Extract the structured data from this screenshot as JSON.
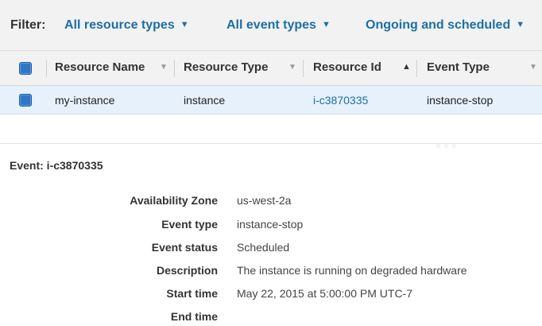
{
  "filter": {
    "label": "Filter:",
    "resource_types": "All resource types",
    "event_types": "All event types",
    "status": "Ongoing and scheduled"
  },
  "table": {
    "columns": [
      "Resource Name",
      "Resource Type",
      "Resource Id",
      "Event Type"
    ],
    "sorted_column": "Resource Id",
    "rows": [
      {
        "resource_name": "my-instance",
        "resource_type": "instance",
        "resource_id": "i-c3870335",
        "event_type": "instance-stop",
        "selected": true
      }
    ]
  },
  "event": {
    "title": "Event: i-c3870335",
    "details": [
      {
        "label": "Availability Zone",
        "value": "us-west-2a"
      },
      {
        "label": "Event type",
        "value": "instance-stop"
      },
      {
        "label": "Event status",
        "value": "Scheduled"
      },
      {
        "label": "Description",
        "value": "The instance is running on degraded hardware"
      },
      {
        "label": "Start time",
        "value": "May 22, 2015 at 5:00:00 PM UTC-7"
      },
      {
        "label": "End time",
        "value": ""
      }
    ]
  },
  "icons": {
    "dropdown": "chevron-down-icon",
    "sort_asc": "sort-ascending-icon",
    "sort_default": "sort-icon",
    "resize": "drag-handle-icon"
  },
  "colors": {
    "link": "#1d6fa5",
    "checkbox": "#2f78c9",
    "selected_row": "#e6f1fb",
    "header_bg": "#f2f2f2"
  }
}
